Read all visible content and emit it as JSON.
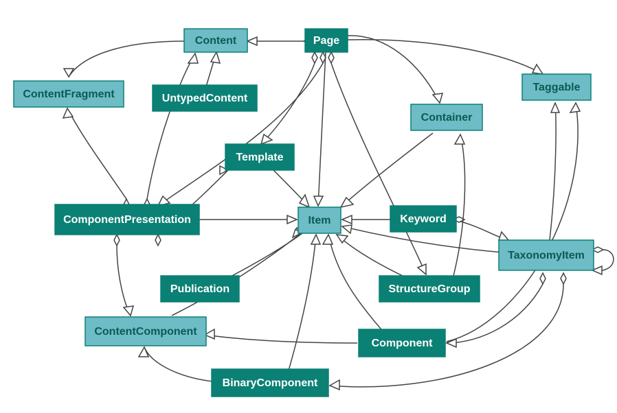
{
  "nodes": {
    "content": {
      "label": "Content",
      "kind": "light"
    },
    "page": {
      "label": "Page",
      "kind": "dark"
    },
    "taggable": {
      "label": "Taggable",
      "kind": "light"
    },
    "contentFragment": {
      "label": "ContentFragment",
      "kind": "light"
    },
    "untypedContent": {
      "label": "UntypedContent",
      "kind": "dark"
    },
    "container": {
      "label": "Container",
      "kind": "light"
    },
    "template": {
      "label": "Template",
      "kind": "dark"
    },
    "componentPresentation": {
      "label": "ComponentPresentation",
      "kind": "dark"
    },
    "item": {
      "label": "Item",
      "kind": "light"
    },
    "keyword": {
      "label": "Keyword",
      "kind": "dark"
    },
    "taxonomyItem": {
      "label": "TaxonomyItem",
      "kind": "light"
    },
    "publication": {
      "label": "Publication",
      "kind": "dark"
    },
    "structureGroup": {
      "label": "StructureGroup",
      "kind": "dark"
    },
    "contentComponent": {
      "label": "ContentComponent",
      "kind": "light"
    },
    "component": {
      "label": "Component",
      "kind": "dark"
    },
    "binaryComponent": {
      "label": "BinaryComponent",
      "kind": "dark"
    }
  },
  "colors": {
    "light_fill": "#6ebcc6",
    "dark_fill": "#0b8075",
    "stroke": "#0b8075",
    "edge": "#444444"
  }
}
